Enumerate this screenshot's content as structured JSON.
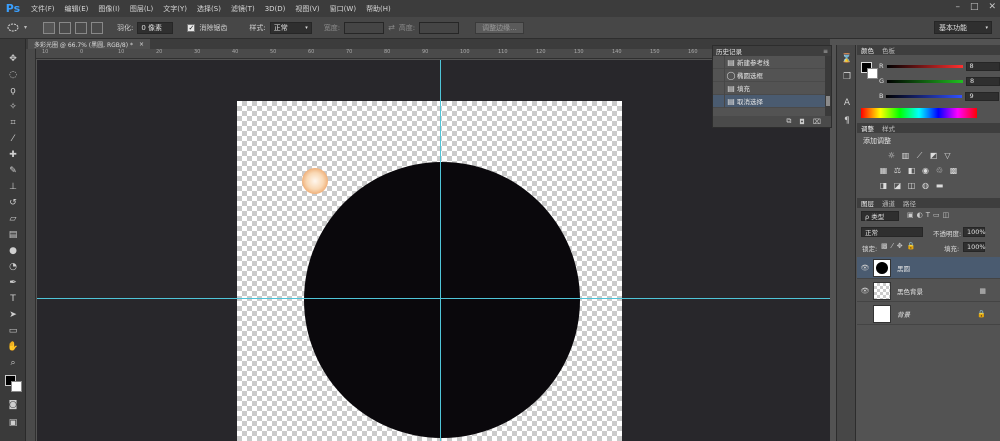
{
  "app": {
    "logo": "Ps"
  },
  "menu": [
    "文件(F)",
    "编辑(E)",
    "图像(I)",
    "图层(L)",
    "文字(Y)",
    "选择(S)",
    "滤镜(T)",
    "3D(D)",
    "视图(V)",
    "窗口(W)",
    "帮助(H)"
  ],
  "window_controls": [
    "–",
    "□",
    "✕"
  ],
  "options": {
    "feather_label": "羽化:",
    "feather_value": "0 像素",
    "antialias_label": "消除锯齿",
    "style_label": "样式:",
    "style_value": "正常",
    "width_label": "宽度:",
    "height_label": "高度:",
    "refine_edge_button": "调整边缘...",
    "workspace": "基本功能"
  },
  "document": {
    "tab_title": "多彩光圈 @ 66.7% (黑圆, RGB/8) *",
    "tab_close": "×",
    "ruler_top": [
      "10",
      "0",
      "10",
      "20",
      "30",
      "40",
      "50",
      "60",
      "70",
      "80",
      "90",
      "100",
      "110",
      "120",
      "130",
      "140",
      "150",
      "160",
      "170",
      "180",
      "190"
    ]
  },
  "history": {
    "tab": "历史记录",
    "items": [
      {
        "label": "新建参考线",
        "icon": "document-icon"
      },
      {
        "label": "椭圆选框",
        "icon": "ellipse-icon"
      },
      {
        "label": "填充",
        "icon": "document-icon"
      },
      {
        "label": "取消选择",
        "icon": "document-icon",
        "selected": true
      }
    ]
  },
  "color_panel": {
    "tabs": [
      "颜色",
      "色板"
    ],
    "channels": [
      {
        "name": "R",
        "value": "8",
        "color": "#ff3030"
      },
      {
        "name": "G",
        "value": "8",
        "color": "#20c020"
      },
      {
        "name": "B",
        "value": "9",
        "color": "#3050ff"
      }
    ]
  },
  "adjust_panel": {
    "tabs": [
      "调整",
      "样式"
    ],
    "title": "添加调整"
  },
  "layers_panel": {
    "tabs": [
      "图层",
      "通道",
      "路径"
    ],
    "filter_label": "ρ 类型",
    "blend_mode": "正常",
    "opacity_label": "不透明度:",
    "opacity_value": "100%",
    "lock_label": "锁定:",
    "fill_label": "填充:",
    "fill_value": "100%",
    "layers": [
      {
        "name": "黑圆",
        "selected": true,
        "visible": true
      },
      {
        "name": "黑色背景",
        "selected": false,
        "visible": true
      },
      {
        "name": "背景",
        "selected": false,
        "visible": false
      }
    ]
  }
}
